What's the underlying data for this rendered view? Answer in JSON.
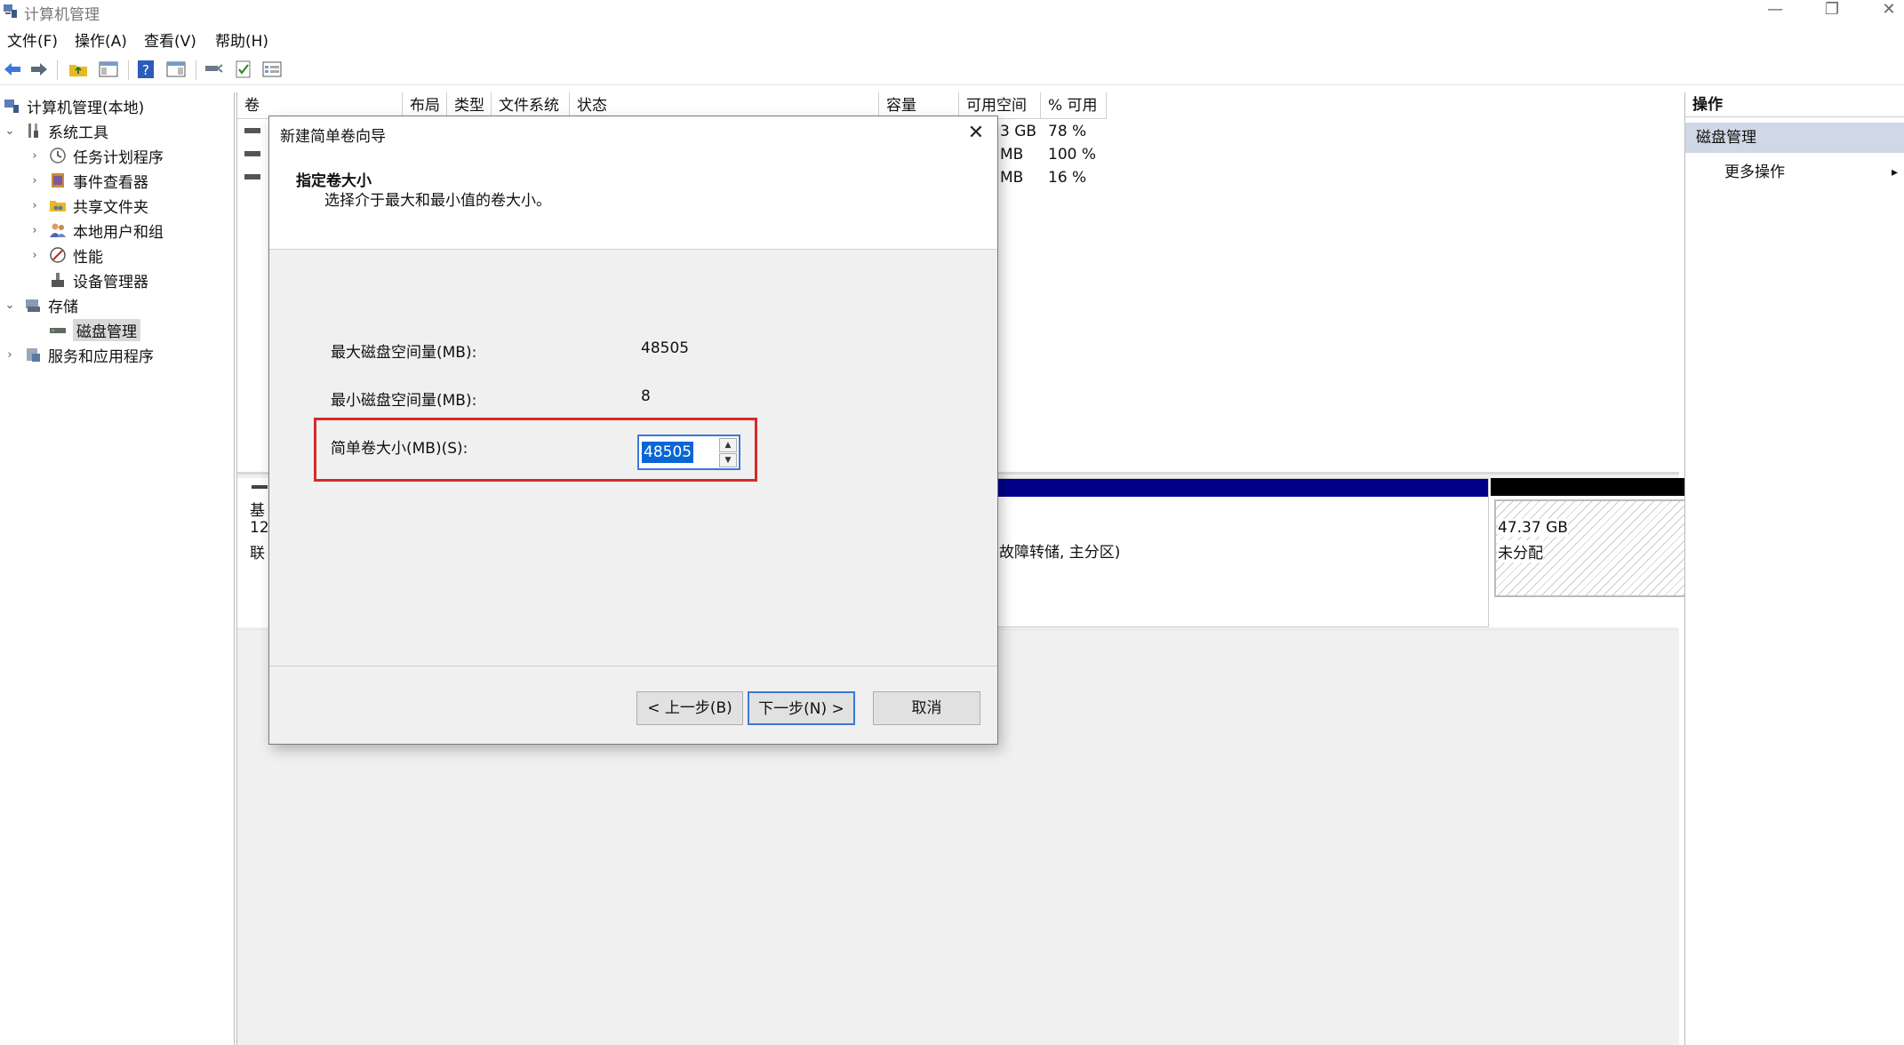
{
  "window": {
    "title": "计算机管理",
    "minimize": "—",
    "restore": "❐",
    "close": "✕"
  },
  "menu": [
    {
      "label": "文件(F)"
    },
    {
      "label": "操作(A)"
    },
    {
      "label": "查看(V)"
    },
    {
      "label": "帮助(H)"
    }
  ],
  "tree": {
    "root": "计算机管理(本地)",
    "items": [
      {
        "label": "系统工具"
      },
      {
        "label": "任务计划程序"
      },
      {
        "label": "事件查看器"
      },
      {
        "label": "共享文件夹"
      },
      {
        "label": "本地用户和组"
      },
      {
        "label": "性能"
      },
      {
        "label": "设备管理器"
      },
      {
        "label": "存储"
      },
      {
        "label": "磁盘管理"
      },
      {
        "label": "服务和应用程序"
      }
    ]
  },
  "volume_table": {
    "columns": [
      "卷",
      "布局",
      "类型",
      "文件系统",
      "状态",
      "容量",
      "可用空间",
      "% 可用"
    ],
    "rows": [
      {
        "free": "3 GB",
        "pct": "78 %"
      },
      {
        "free": "MB",
        "pct": "100 %"
      },
      {
        "free": "MB",
        "pct": "16 %"
      }
    ]
  },
  "disk_map": {
    "disk_label_lines": [
      "基",
      "12",
      "联"
    ],
    "partition_status": "故障转储, 主分区)",
    "unallocated_size": "47.37 GB",
    "unallocated_label": "未分配"
  },
  "ops_panel": {
    "header": "操作",
    "selected": "磁盘管理",
    "more": "更多操作",
    "more_arrow": "▸"
  },
  "dialog": {
    "title": "新建简单卷向导",
    "close": "✕",
    "heading": "指定卷大小",
    "subheading": "选择介于最大和最小值的卷大小。",
    "max_label": "最大磁盘空间量(MB):",
    "max_value": "48505",
    "min_label": "最小磁盘空间量(MB):",
    "min_value": "8",
    "size_label": "简单卷大小(MB)(S):",
    "size_value": "48505",
    "back_button": "< 上一步(B)",
    "next_button": "下一步(N) >",
    "cancel_button": "取消"
  },
  "colors": {
    "accent": "#3b78d8",
    "highlight": "#d62a2a",
    "partition_bar": "#00008b",
    "unallocated_bar": "#000000",
    "selection": "#0a66d6"
  }
}
